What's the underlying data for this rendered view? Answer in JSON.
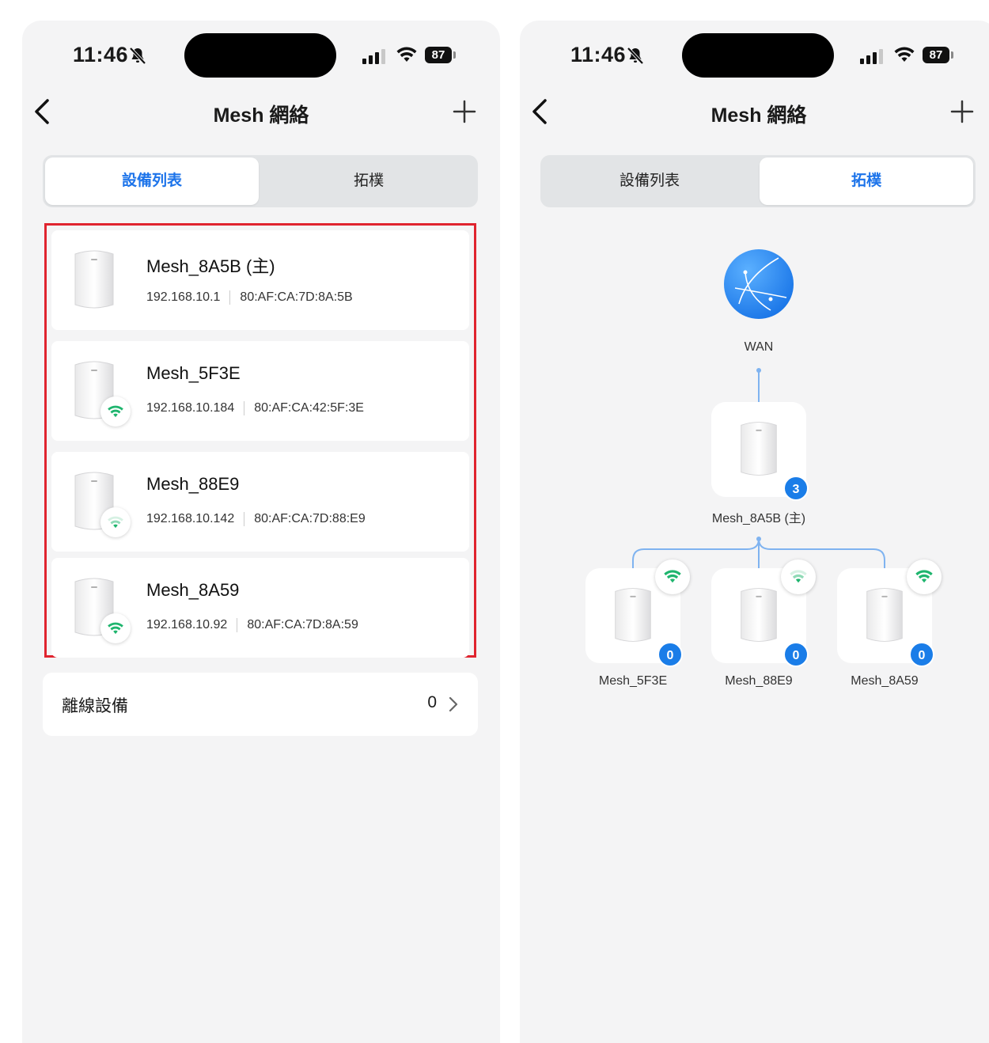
{
  "status": {
    "time": "11:46",
    "battery": "87"
  },
  "nav": {
    "title": "Mesh 網絡"
  },
  "tabs": {
    "device_list": "設備列表",
    "topology": "拓樸"
  },
  "devices": [
    {
      "name": "Mesh_8A5B (主)",
      "ip": "192.168.10.1",
      "mac": "80:AF:CA:7D:8A:5B",
      "wifi": false
    },
    {
      "name": "Mesh_5F3E",
      "ip": "192.168.10.184",
      "mac": "80:AF:CA:42:5F:3E",
      "wifi": true
    },
    {
      "name": "Mesh_88E9",
      "ip": "192.168.10.142",
      "mac": "80:AF:CA:7D:88:E9",
      "wifi": true
    },
    {
      "name": "Mesh_8A59",
      "ip": "192.168.10.92",
      "mac": "80:AF:CA:7D:8A:59",
      "wifi": true
    }
  ],
  "offline": {
    "label": "離線設備",
    "count": "0"
  },
  "topology": {
    "wan_label": "WAN",
    "main": {
      "name": "Mesh_8A5B (主)",
      "count": "3"
    },
    "nodes": [
      {
        "name": "Mesh_5F3E",
        "count": "0"
      },
      {
        "name": "Mesh_88E9",
        "count": "0"
      },
      {
        "name": "Mesh_8A59",
        "count": "0"
      }
    ]
  },
  "colors": {
    "accent": "#1d74ea",
    "highlight_border": "#e0242f",
    "wifi_green": "#1fb56e",
    "badge_blue": "#1a7de8"
  },
  "icons": [
    "back-chevron-icon",
    "plus-icon",
    "wifi-icon",
    "globe-icon",
    "mesh-router-icon",
    "chevron-right-icon",
    "bell-slash-icon",
    "signal-icon",
    "battery-icon"
  ]
}
